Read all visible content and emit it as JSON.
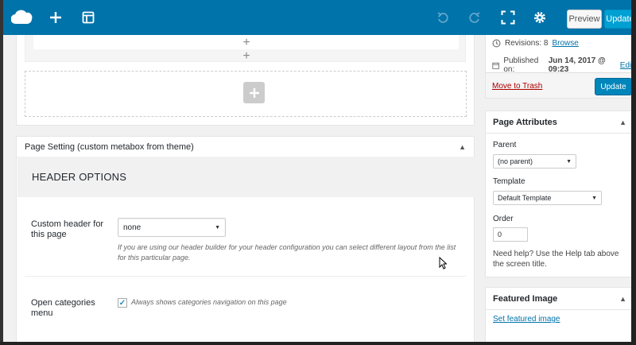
{
  "toolbar": {
    "icons": [
      "cloud-logo-icon",
      "plus-icon",
      "layout-icon",
      "undo-icon",
      "redo-icon",
      "fullscreen-icon",
      "gear-icon"
    ],
    "preview_label": "Preview",
    "update_label": "Update"
  },
  "publish": {
    "revisions_label": "Revisions: 8",
    "revisions_link": "Browse",
    "published_label": "Published on:",
    "published_date": "Jun 14, 2017 @ 09:23",
    "edit_link": "Edit",
    "trash_link": "Move to Trash",
    "update_label": "Update"
  },
  "metabox": {
    "title": "Page Setting (custom metabox from theme)",
    "section_title": "HEADER OPTIONS",
    "custom_header": {
      "label": "Custom header for this page",
      "selected": "none",
      "help": "If you are using our header builder for your header configuration you can select different layout from the list for this particular page."
    },
    "categories": {
      "label": "Open categories menu",
      "checked": true,
      "text": "Always shows categories navigation on this page"
    }
  },
  "page_attributes": {
    "title": "Page Attributes",
    "parent_label": "Parent",
    "parent_selected": "(no parent)",
    "template_label": "Template",
    "template_selected": "Default Template",
    "order_label": "Order",
    "order_value": "0",
    "help": "Need help? Use the Help tab above the screen title."
  },
  "featured_image": {
    "title": "Featured Image",
    "link": "Set featured image"
  },
  "colors": {
    "toolbar_bg": "#0073aa",
    "primary_button": "#0085ba",
    "trash_link": "#a00000"
  }
}
